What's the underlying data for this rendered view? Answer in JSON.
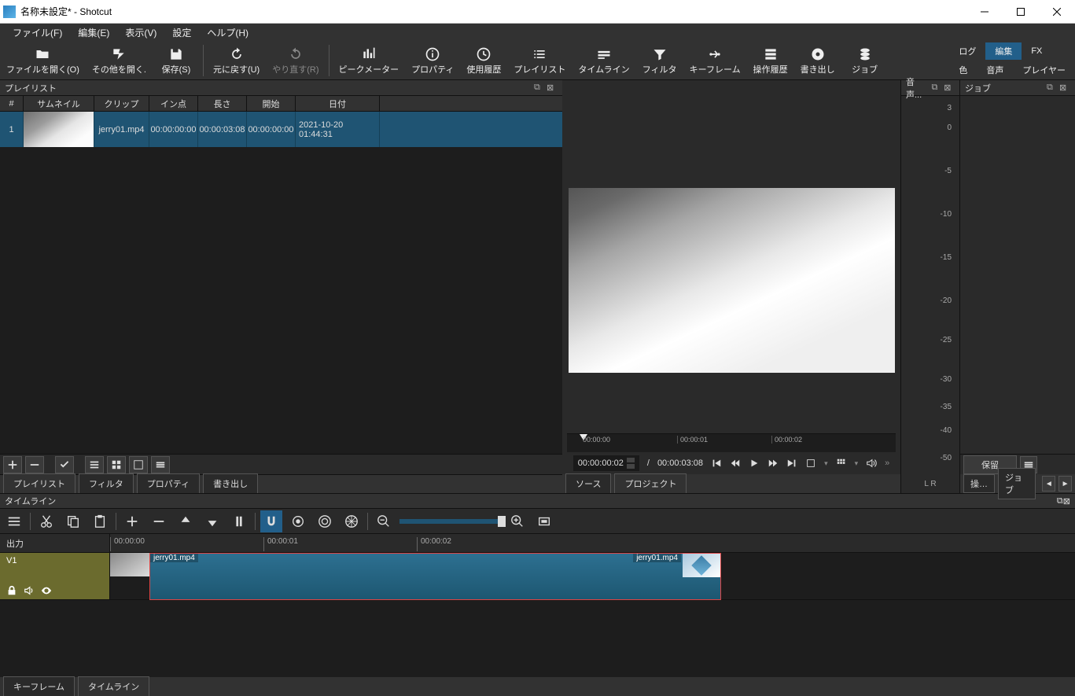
{
  "window": {
    "title": "名称未設定* - Shotcut"
  },
  "menu": {
    "file": "ファイル(F)",
    "edit": "編集(E)",
    "view": "表示(V)",
    "settings": "設定",
    "help": "ヘルプ(H)"
  },
  "toolbar": {
    "open": "ファイルを開く(O)",
    "openother": "その他を開く.",
    "save": "保存(S)",
    "undo": "元に戻す(U)",
    "redo": "やり直す(R)",
    "peak": "ピークメーター",
    "prop": "プロパティ",
    "recent": "使用履歴",
    "playlist": "プレイリスト",
    "timeline": "タイムライン",
    "filter": "フィルタ",
    "keyframe": "キーフレーム",
    "history": "操作履歴",
    "export": "書き出し",
    "jobs": "ジョブ"
  },
  "righttabs": {
    "log": "ログ",
    "edit": "編集",
    "fx": "FX",
    "color": "色",
    "audio": "音声",
    "player": "プレイヤー"
  },
  "playlist": {
    "title": "プレイリスト",
    "cols": {
      "idx": "#",
      "thumb": "サムネイル",
      "clip": "クリップ",
      "in": "イン点",
      "len": "長さ",
      "start": "開始",
      "date": "日付"
    },
    "row": {
      "idx": "1",
      "clip": "jerry01.mp4",
      "in": "00:00:00:00",
      "len": "00:00:03:08",
      "start": "00:00:00:00",
      "date": "2021-10-20 01:44:31"
    },
    "tabs": {
      "playlist": "プレイリスト",
      "filter": "フィルタ",
      "prop": "プロパティ",
      "export": "書き出し"
    }
  },
  "player": {
    "ticks": {
      "t0": "00:00:00",
      "t1": "00:00:01",
      "t2": "00:00:02"
    },
    "pos": "00:00:00:02",
    "dur": "00:00:03:08",
    "tabs": {
      "source": "ソース",
      "project": "プロジェクト"
    }
  },
  "audiopanel": {
    "title": "音声...",
    "lr": "L   R",
    "db": {
      "p3": "3",
      "z": "0",
      "m5": "-5",
      "m10": "-10",
      "m15": "-15",
      "m20": "-20",
      "m25": "-25",
      "m30": "-30",
      "m35": "-35",
      "m40": "-40",
      "m50": "-50"
    }
  },
  "jobspanel": {
    "title": "ジョブ",
    "hold": "保留",
    "ops": "操…",
    "jobs": "ジョブ"
  },
  "timeline": {
    "title": "タイムライン",
    "output": "出力",
    "track": "V1",
    "ruler": {
      "t0": "00:00:00",
      "t1": "00:00:01",
      "t2": "00:00:02"
    },
    "cliplabel": "jerry01.mp4"
  },
  "bottomtabs": {
    "kf": "キーフレーム",
    "tl": "タイムライン"
  }
}
